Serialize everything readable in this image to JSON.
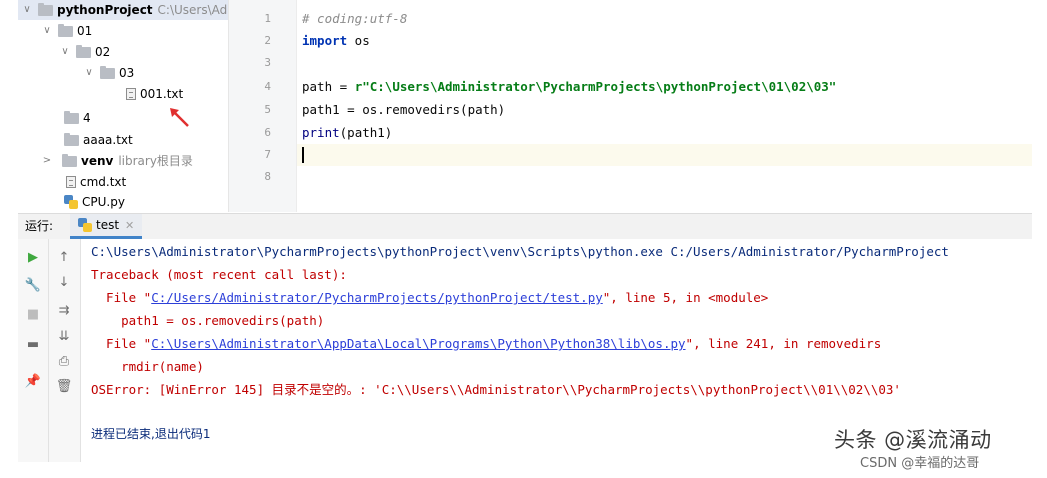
{
  "project_tree": {
    "root": {
      "name": "pythonProject",
      "path": "C:\\Users\\Ad"
    },
    "items": [
      {
        "label": "01"
      },
      {
        "label": "02"
      },
      {
        "label": "03"
      },
      {
        "label": "001.txt"
      },
      {
        "label": "4"
      },
      {
        "label": "aaaa.txt"
      },
      {
        "label": "venv",
        "suffix": "library根目录"
      },
      {
        "label": "cmd.txt"
      },
      {
        "label": "CPU.py"
      }
    ]
  },
  "editor": {
    "line_numbers": [
      "1",
      "2",
      "3",
      "4",
      "5",
      "6",
      "7",
      "8"
    ],
    "lines": {
      "l1": "# coding:utf-8",
      "l2_kw": "import",
      "l2_rest": " os",
      "l4_pre": "path = ",
      "l4_str": "r\"C:\\Users\\Administrator\\PycharmProjects\\pythonProject\\01\\02\\03\"",
      "l5": "path1 = os.removedirs(path)",
      "l6_fn": "print",
      "l6_rest": "(path1)"
    }
  },
  "run_panel": {
    "label": "运行:",
    "tab": "test",
    "output": {
      "cmd": "C:\\Users\\Administrator\\PycharmProjects\\pythonProject\\venv\\Scripts\\python.exe C:/Users/Administrator/PycharmProject",
      "traceback": "Traceback (most recent call last):",
      "file1_pre": "  File \"",
      "file1_link": "C:/Users/Administrator/PycharmProjects/pythonProject/test.py",
      "file1_post": "\", line 5, in <module>",
      "code1": "    path1 = os.removedirs(path)",
      "file2_pre": "  File \"",
      "file2_link": "C:\\Users\\Administrator\\AppData\\Local\\Programs\\Python\\Python38\\lib\\os.py",
      "file2_post": "\", line 241, in removedirs",
      "code2": "    rmdir(name)",
      "error": "OSError: [WinError 145] 目录不是空的。: 'C:\\\\Users\\\\Administrator\\\\PycharmProjects\\\\pythonProject\\\\01\\\\02\\\\03'",
      "exit": "进程已结束,退出代码1"
    }
  },
  "watermark": {
    "main": "头条 @溪流涌动",
    "sub": "CSDN @幸福的达哥"
  },
  "colors": {
    "keyword": "#0033b3",
    "string": "#067d17",
    "error": "#c00000",
    "link": "#2c3fd8",
    "selection": "#e2e8f3"
  }
}
